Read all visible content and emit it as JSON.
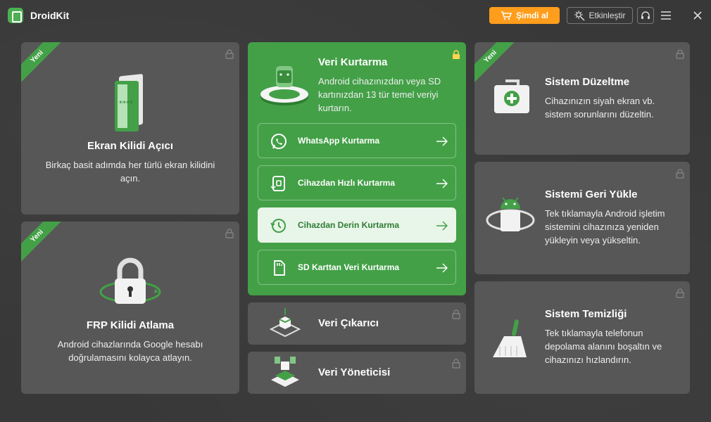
{
  "app": {
    "name": "DroidKit"
  },
  "titlebar": {
    "buy_label": "Şimdi al",
    "activate_label": "Etkinleştir"
  },
  "badge_new": "Yeni",
  "cards": {
    "screen_unlock": {
      "title": "Ekran Kilidi Açıcı",
      "desc": "Birkaç basit adımda her türlü ekran kilidini açın."
    },
    "frp": {
      "title": "FRP Kilidi Atlama",
      "desc": "Android cihazlarında Google hesabı doğrulamasını kolayca atlayın."
    },
    "data_recovery": {
      "title": "Veri Kurtarma",
      "desc": "Android cihazınızdan veya SD kartınızdan 13 tür temel veriyi kurtarın.",
      "items": [
        {
          "label": "WhatsApp Kurtarma"
        },
        {
          "label": "Cihazdan Hızlı Kurtarma"
        },
        {
          "label": "Cihazdan Derin Kurtarma"
        },
        {
          "label": "SD Karttan Veri Kurtarma"
        }
      ]
    },
    "extractor": {
      "title": "Veri Çıkarıcı"
    },
    "manager": {
      "title": "Veri Yöneticisi"
    },
    "system_fix": {
      "title": "Sistem Düzeltme",
      "desc": "Cihazınızın siyah ekran vb. sistem sorunlarını düzeltin."
    },
    "reinstall": {
      "title": "Sistemi Geri Yükle",
      "desc": "Tek tıklamayla Android işletim sistemini cihazınıza yeniden yükleyin veya yükseltin."
    },
    "cleaner": {
      "title": "Sistem Temizliği",
      "desc": "Tek tıklamayla telefonun depolama alanını boşaltın ve cihazınızı hızlandırın."
    }
  },
  "colors": {
    "accent": "#43a047",
    "buy": "#ff9d1c",
    "card": "#575757",
    "background": "#383838"
  }
}
